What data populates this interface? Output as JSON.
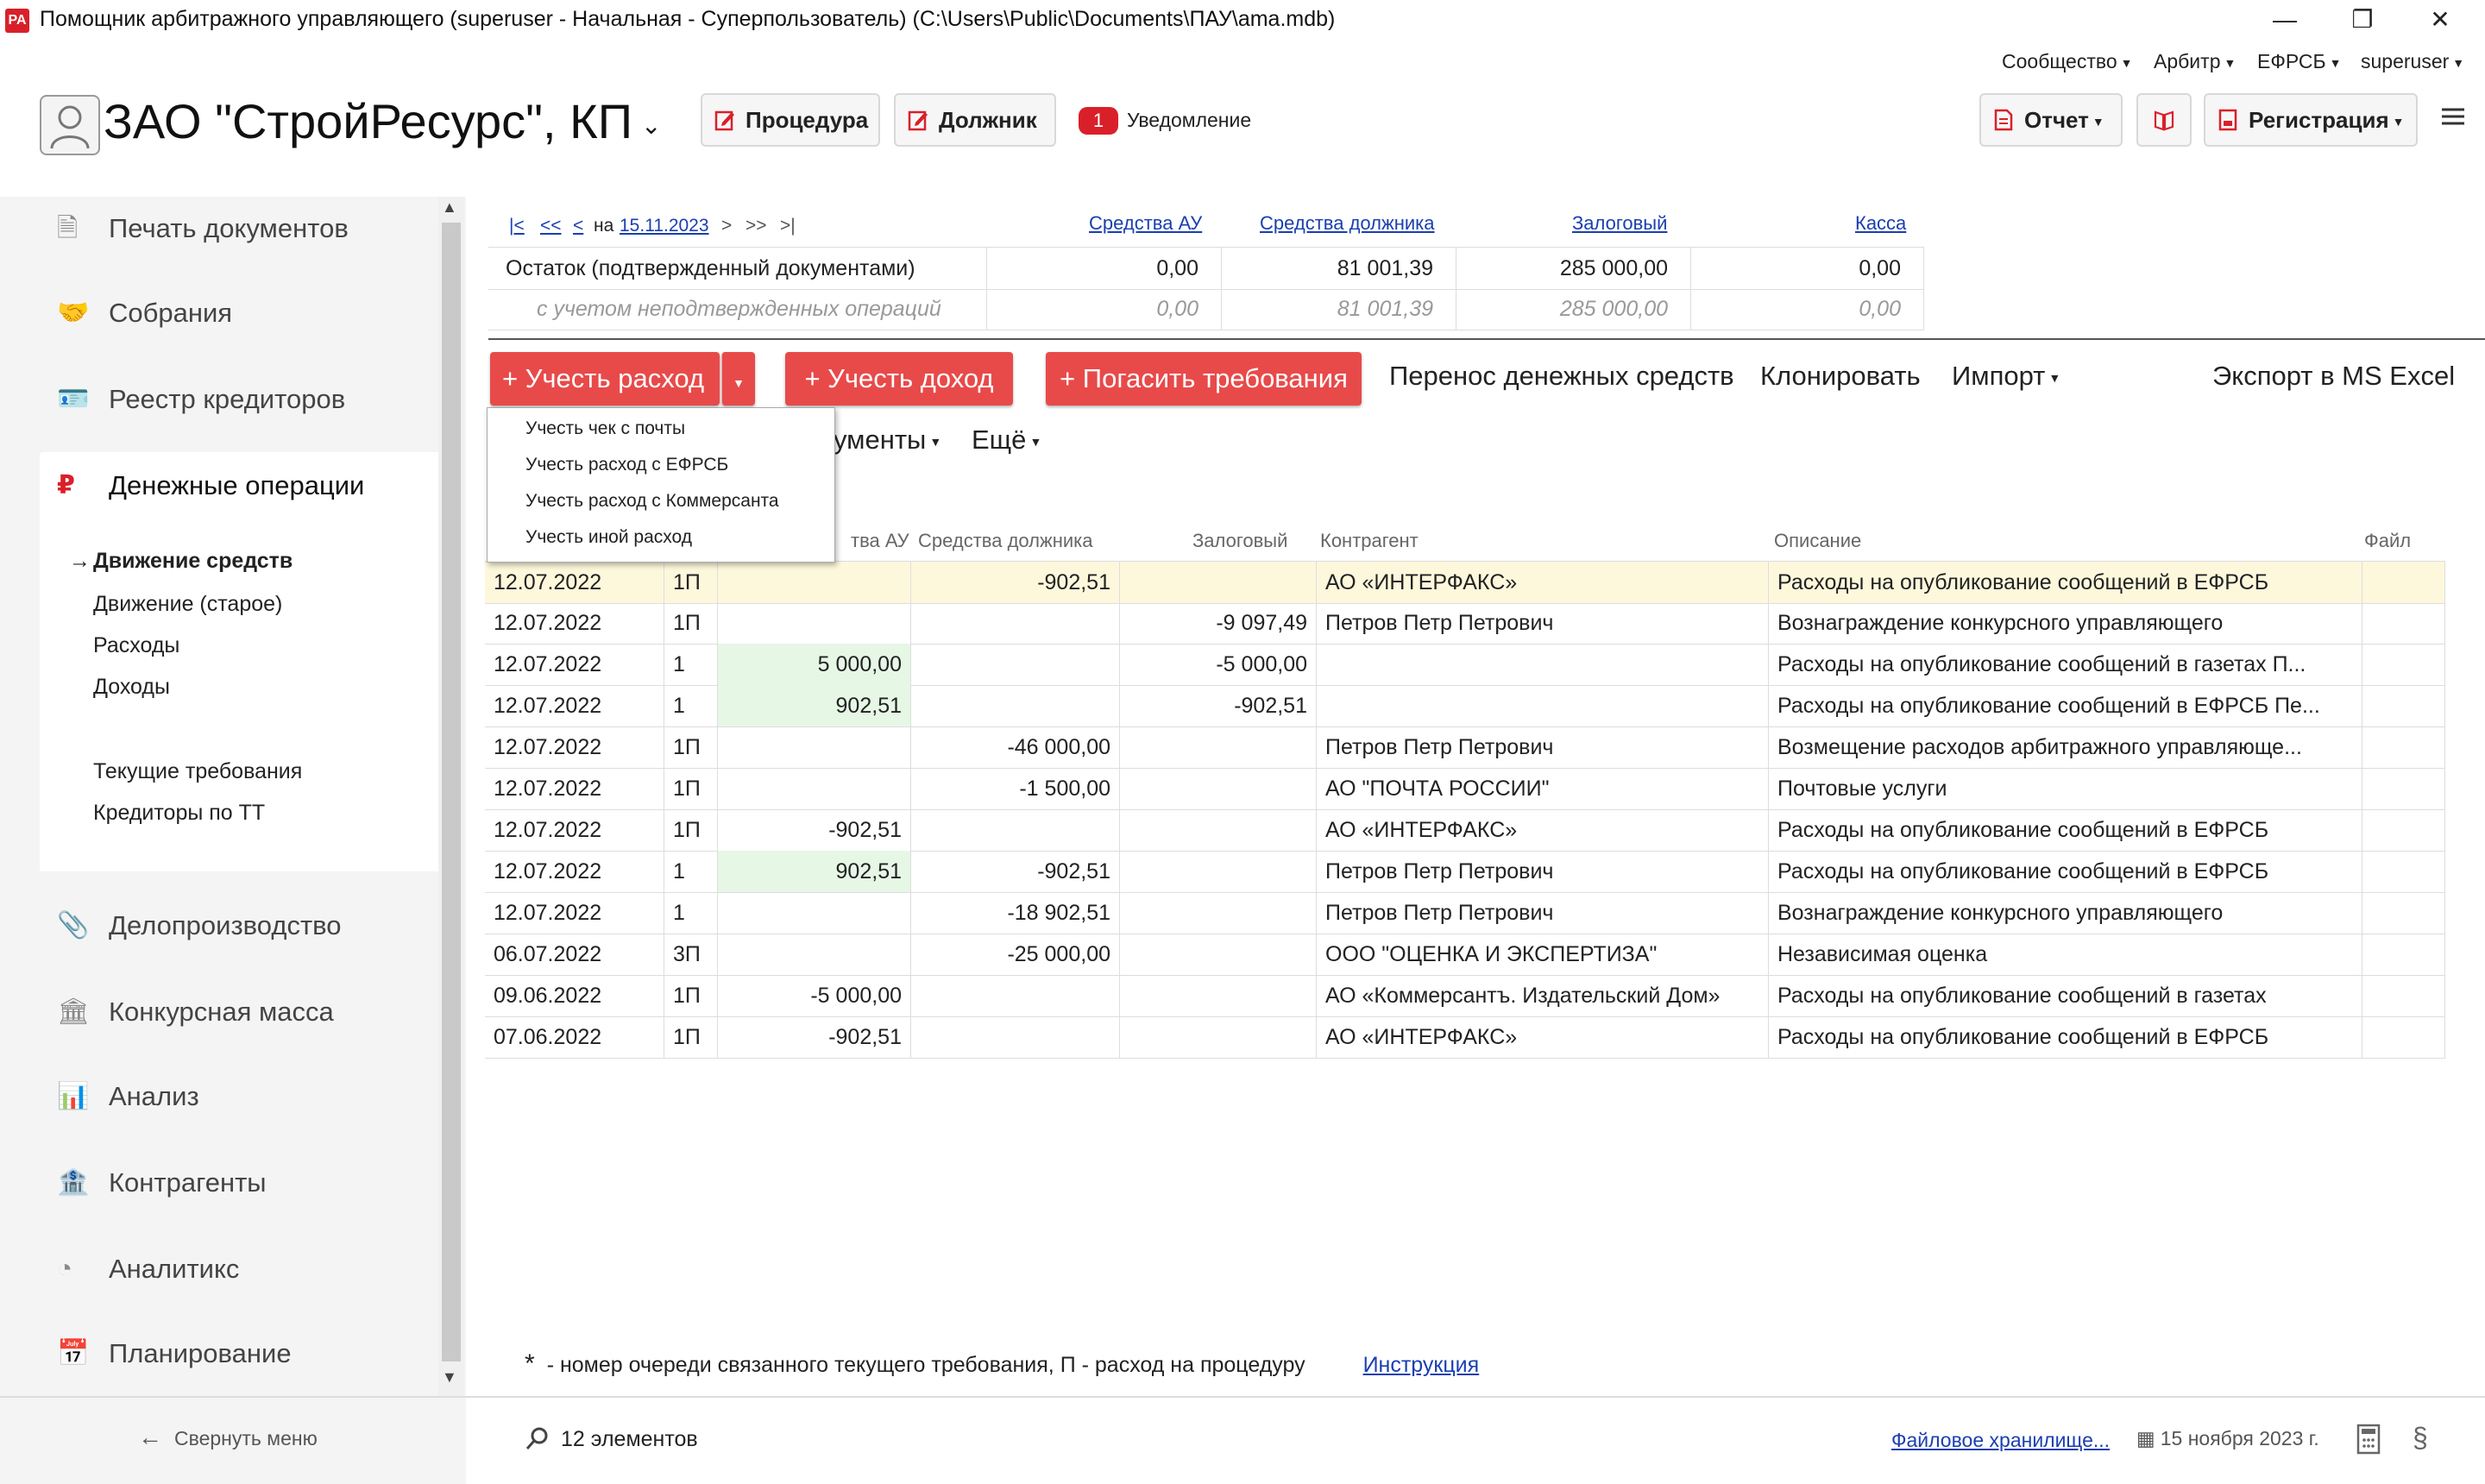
{
  "window": {
    "title": "Помощник арбитражного управляющего (superuser - Начальная - Суперпользователь) (C:\\Users\\Public\\Documents\\ПАУ\\ama.mdb)",
    "app_icon_text": "PA"
  },
  "top_menu": {
    "community": "Сообщество",
    "arbitr": "Арбитр",
    "efrsb": "ЕФРСБ",
    "user": "superuser"
  },
  "header": {
    "org_name": "ЗАО \"СтройРесурс\", КП",
    "procedure_btn": "Процедура",
    "debtor_btn": "Должник",
    "notif_count": "1",
    "notif_label": "Уведомление",
    "report_btn": "Отчет",
    "registration_btn": "Регистрация"
  },
  "sidebar": {
    "items": [
      {
        "label": "Печать документов",
        "icon": "document-icon"
      },
      {
        "label": "Собрания",
        "icon": "handshake-icon"
      },
      {
        "label": "Реестр кредиторов",
        "icon": "id-card-icon"
      },
      {
        "label": "Денежные операции",
        "icon": "ruble-icon"
      },
      {
        "label": "Делопроизводство",
        "icon": "paperclip-icon"
      },
      {
        "label": "Конкурсная масса",
        "icon": "bank-icon"
      },
      {
        "label": "Анализ",
        "icon": "bar-chart-icon"
      },
      {
        "label": "Контрагенты",
        "icon": "building-icon"
      },
      {
        "label": "Аналитикс",
        "icon": "analytics-icon"
      },
      {
        "label": "Планирование",
        "icon": "calendar-icon"
      }
    ],
    "subitems": [
      "Движение средств",
      "Движение (старое)",
      "Расходы",
      "Доходы",
      "Текущие требования",
      "Кредиторы по ТТ"
    ],
    "collapse_label": "Свернуть меню"
  },
  "balance": {
    "nav": {
      "first": "|<",
      "prev2": "<<",
      "prev": "<",
      "on_label": "на",
      "date": "15.11.2023",
      "next": ">",
      "next2": ">>",
      "last": ">|"
    },
    "columns": [
      "Средства АУ",
      "Средства должника",
      "Залоговый",
      "Касса"
    ],
    "rows": [
      {
        "label": "Остаток (подтвержденный документами)",
        "values": [
          "0,00",
          "81 001,39",
          "285 000,00",
          "0,00"
        ]
      },
      {
        "label": "с учетом неподтвержденных операций",
        "values": [
          "0,00",
          "81 001,39",
          "285 000,00",
          "0,00"
        ]
      }
    ]
  },
  "actions": {
    "expense_btn": "+ Учесть расход",
    "income_btn": "+ Учесть доход",
    "repay_btn": "+ Погасить требования",
    "transfer_btn": "Перенос денежных средств",
    "clone_btn": "Клонировать",
    "import_btn": "Импорт",
    "export_btn": "Экспорт в MS Excel",
    "documents_partial": "ументы",
    "more_btn": "Ещё"
  },
  "dropdown": {
    "items": [
      "Учесть чек с почты",
      "Учесть расход с ЕФРСБ",
      "Учесть расход с Коммерсанта",
      "Учесть иной расход"
    ]
  },
  "grid": {
    "headers": {
      "au_partial": "тва АУ",
      "debtor": "Средства должника",
      "pledge": "Залоговый",
      "counterparty": "Контрагент",
      "description": "Описание",
      "file": "Файл"
    },
    "rows": [
      {
        "date": "12.07.2022",
        "q": "1П",
        "au": "",
        "debtor": "-902,51",
        "pledge": "",
        "cp": "АО «ИНТЕРФАКС»",
        "desc": "Расходы на опубликование сообщений в ЕФРСБ"
      },
      {
        "date": "12.07.2022",
        "q": "1П",
        "au": "",
        "debtor": "",
        "pledge": "-9 097,49",
        "cp": "Петров Петр Петрович",
        "desc": "Вознаграждение конкурсного управляющего"
      },
      {
        "date": "12.07.2022",
        "q": "1",
        "au": "5 000,00",
        "debtor": "",
        "pledge": "-5 000,00",
        "cp": "",
        "desc": "Расходы на опубликование сообщений в газетах П..."
      },
      {
        "date": "12.07.2022",
        "q": "1",
        "au": "902,51",
        "debtor": "",
        "pledge": "-902,51",
        "cp": "",
        "desc": "Расходы на опубликование сообщений в ЕФРСБ Пе..."
      },
      {
        "date": "12.07.2022",
        "q": "1П",
        "au": "",
        "debtor": "-46 000,00",
        "pledge": "",
        "cp": "Петров Петр Петрович",
        "desc": "Возмещение расходов арбитражного управляюще..."
      },
      {
        "date": "12.07.2022",
        "q": "1П",
        "au": "",
        "debtor": "-1 500,00",
        "pledge": "",
        "cp": "АО \"ПОЧТА РОССИИ\"",
        "desc": "Почтовые услуги"
      },
      {
        "date": "12.07.2022",
        "q": "1П",
        "au": "-902,51",
        "debtor": "",
        "pledge": "",
        "cp": "АО «ИНТЕРФАКС»",
        "desc": "Расходы на опубликование сообщений в ЕФРСБ"
      },
      {
        "date": "12.07.2022",
        "q": "1",
        "au": "902,51",
        "debtor": "-902,51",
        "pledge": "",
        "cp": "Петров Петр Петрович",
        "desc": "Расходы на опубликование сообщений в ЕФРСБ"
      },
      {
        "date": "12.07.2022",
        "q": "1",
        "au": "",
        "debtor": "-18 902,51",
        "pledge": "",
        "cp": "Петров Петр Петрович",
        "desc": "Вознаграждение конкурсного управляющего"
      },
      {
        "date": "06.07.2022",
        "q": "3П",
        "au": "",
        "debtor": "-25 000,00",
        "pledge": "",
        "cp": "ООО \"ОЦЕНКА И ЭКСПЕРТИЗА\"",
        "desc": "Независимая оценка"
      },
      {
        "date": "09.06.2022",
        "q": "1П",
        "au": "-5 000,00",
        "debtor": "",
        "pledge": "",
        "cp": "АО «Коммерсантъ. Издательский Дом»",
        "desc": "Расходы на опубликование сообщений в газетах"
      },
      {
        "date": "07.06.2022",
        "q": "1П",
        "au": "-902,51",
        "debtor": "",
        "pledge": "",
        "cp": "АО «ИНТЕРФАКС»",
        "desc": "Расходы на опубликование сообщений в ЕФРСБ"
      }
    ]
  },
  "footer": {
    "asterisk": "*",
    "note": "- номер очереди связанного текущего требования, П - расход на процедуру",
    "instruction_link": "Инструкция",
    "count": "12 элементов",
    "storage_link": "Файловое хранилище...",
    "date": "15 ноября 2023 г.",
    "section_sign": "§"
  },
  "colors": {
    "accent_red": "#e84a4a",
    "highlight_row": "#fdf8dc",
    "green_cell": "#e6f7e6",
    "link": "#1a3fb0"
  }
}
